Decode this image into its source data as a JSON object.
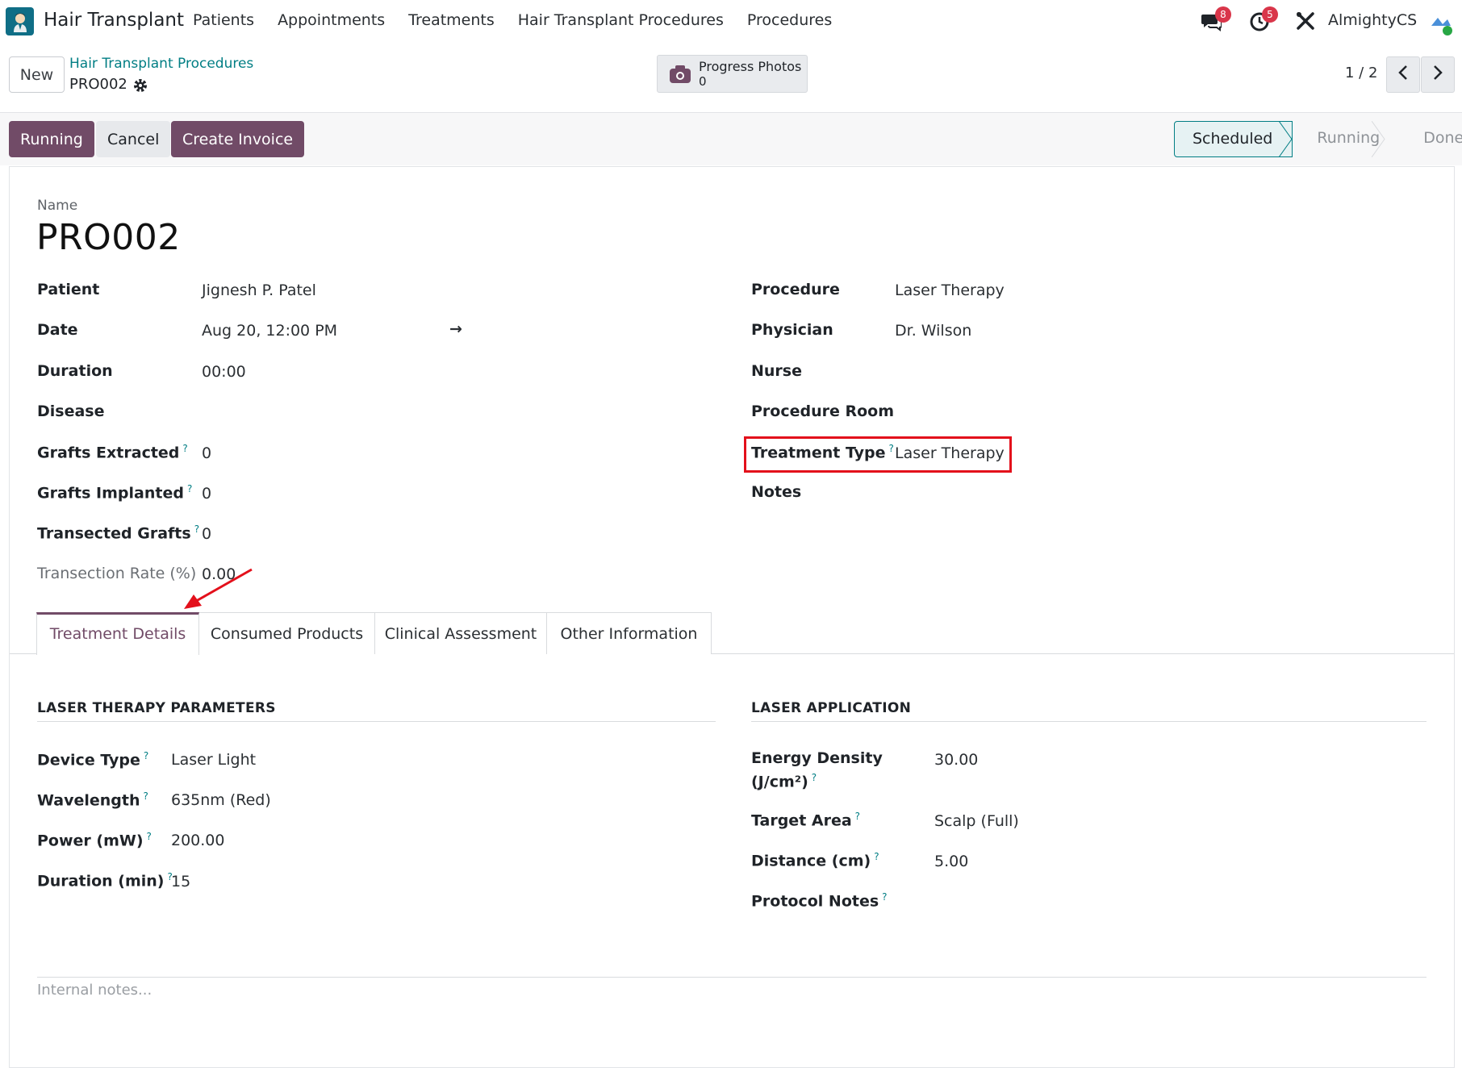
{
  "navbar": {
    "app_name": "Hair Transplant",
    "menu": [
      "Patients",
      "Appointments",
      "Treatments",
      "Hair Transplant Procedures",
      "Procedures"
    ],
    "messages_count": "8",
    "activities_count": "5",
    "company": "AlmightyCS"
  },
  "control": {
    "new_label": "New",
    "breadcrumb": "Hair Transplant Procedures",
    "record": "PRO002",
    "smart_button": {
      "label": "Progress Photos",
      "count": "0"
    },
    "pager": "1 / 2"
  },
  "actions": {
    "running": "Running",
    "cancel": "Cancel",
    "create_invoice": "Create Invoice"
  },
  "statusbar": [
    "Scheduled",
    "Running",
    "Done"
  ],
  "form": {
    "name_label": "Name",
    "name": "PRO002",
    "left_fields": [
      {
        "label": "Patient",
        "value": "Jignesh P. Patel"
      },
      {
        "label": "Date",
        "value": "Aug 20, 12:00 PM"
      },
      {
        "label": "Duration",
        "value": "00:00"
      },
      {
        "label": "Disease",
        "value": ""
      },
      {
        "label": "Grafts Extracted",
        "value": "0"
      },
      {
        "label": "Grafts Implanted",
        "value": "0"
      },
      {
        "label": "Transected Grafts",
        "value": "0"
      },
      {
        "label": "Transection Rate (%)",
        "value": "0.00"
      }
    ],
    "right_fields": [
      {
        "label": "Procedure",
        "value": "Laser Therapy"
      },
      {
        "label": "Physician",
        "value": "Dr. Wilson"
      },
      {
        "label": "Nurse",
        "value": ""
      },
      {
        "label": "Procedure Room",
        "value": ""
      },
      {
        "label": "Treatment Type",
        "value": "Laser Therapy"
      },
      {
        "label": "Notes",
        "value": ""
      }
    ],
    "date_arrow": "→",
    "help_mark": "?"
  },
  "tabs": [
    "Treatment Details",
    "Consumed Products",
    "Clinical Assessment",
    "Other Information"
  ],
  "laser_params": {
    "title": "LASER THERAPY PARAMETERS",
    "fields": [
      {
        "label": "Device Type",
        "value": "Laser Light"
      },
      {
        "label": "Wavelength",
        "value": "635nm (Red)"
      },
      {
        "label": "Power (mW)",
        "value": "200.00"
      },
      {
        "label": "Duration (min)",
        "value": "15"
      }
    ]
  },
  "laser_application": {
    "title": "LASER APPLICATION",
    "fields": [
      {
        "label_line1": "Energy Density",
        "label_line2": "(J/cm²)",
        "value": "30.00"
      },
      {
        "label": "Target Area",
        "value": "Scalp (Full)"
      },
      {
        "label": "Distance (cm)",
        "value": "5.00"
      },
      {
        "label": "Protocol Notes",
        "value": ""
      }
    ]
  },
  "internal_notes_placeholder": "Internal notes...",
  "colors": {
    "primary": "#714b67",
    "accent": "#017e84",
    "highlight": "#e3101b"
  },
  "icons": [
    "app-logo-icon",
    "chat-icon",
    "clock-icon",
    "tools-icon",
    "avatar-icon",
    "gear-icon",
    "camera-icon",
    "chevron-left-icon",
    "chevron-right-icon",
    "arrow-right-icon"
  ]
}
